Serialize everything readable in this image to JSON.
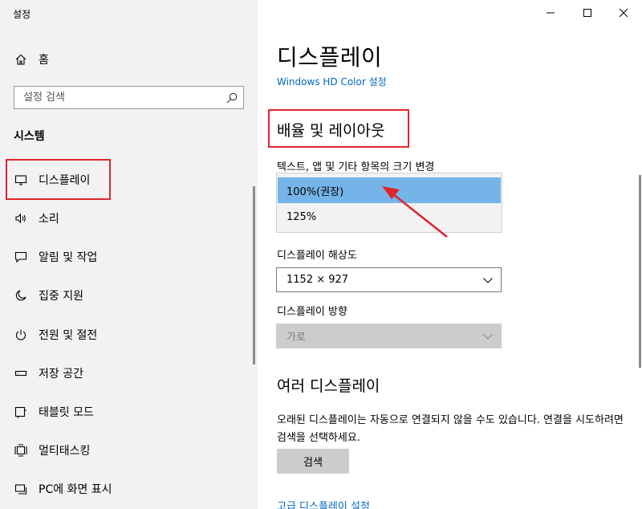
{
  "window": {
    "title": "설정"
  },
  "sidebar": {
    "home_label": "홈",
    "search_placeholder": "설정 검색",
    "section_title": "시스템",
    "items": [
      {
        "label": "디스플레이",
        "icon": "monitor-icon"
      },
      {
        "label": "소리",
        "icon": "speaker-icon"
      },
      {
        "label": "알림 및 작업",
        "icon": "notification-icon"
      },
      {
        "label": "집중 지원",
        "icon": "moon-icon"
      },
      {
        "label": "전원 및 절전",
        "icon": "power-icon"
      },
      {
        "label": "저장 공간",
        "icon": "storage-icon"
      },
      {
        "label": "태블릿 모드",
        "icon": "tablet-icon"
      },
      {
        "label": "멀티태스킹",
        "icon": "multitask-icon"
      },
      {
        "label": "PC에 화면 표시",
        "icon": "project-icon"
      }
    ]
  },
  "main": {
    "title": "디스플레이",
    "hd_color_link": "Windows HD Color 설정",
    "scale_heading": "배율 및 레이아웃",
    "scale_label": "텍스트, 앱 및 기타 항목의 크기 변경",
    "scale_options": [
      "100%(권장)",
      "125%"
    ],
    "resolution_label": "디스플레이 해상도",
    "resolution_value": "1152 × 927",
    "orientation_label": "디스플레이 방향",
    "orientation_value": "가로",
    "multi_heading": "여러 디스플레이",
    "multi_desc": "오래된 디스플레이는 자동으로 연결되지 않을 수도 있습니다. 연결을 시도하려면 검색을 선택하세요.",
    "detect_button": "검색",
    "advanced_link": "고급 디스플레이 설정"
  },
  "colors": {
    "highlight_box": "#e0262c",
    "selected_option": "#75b4e8",
    "link": "#0067c0"
  }
}
